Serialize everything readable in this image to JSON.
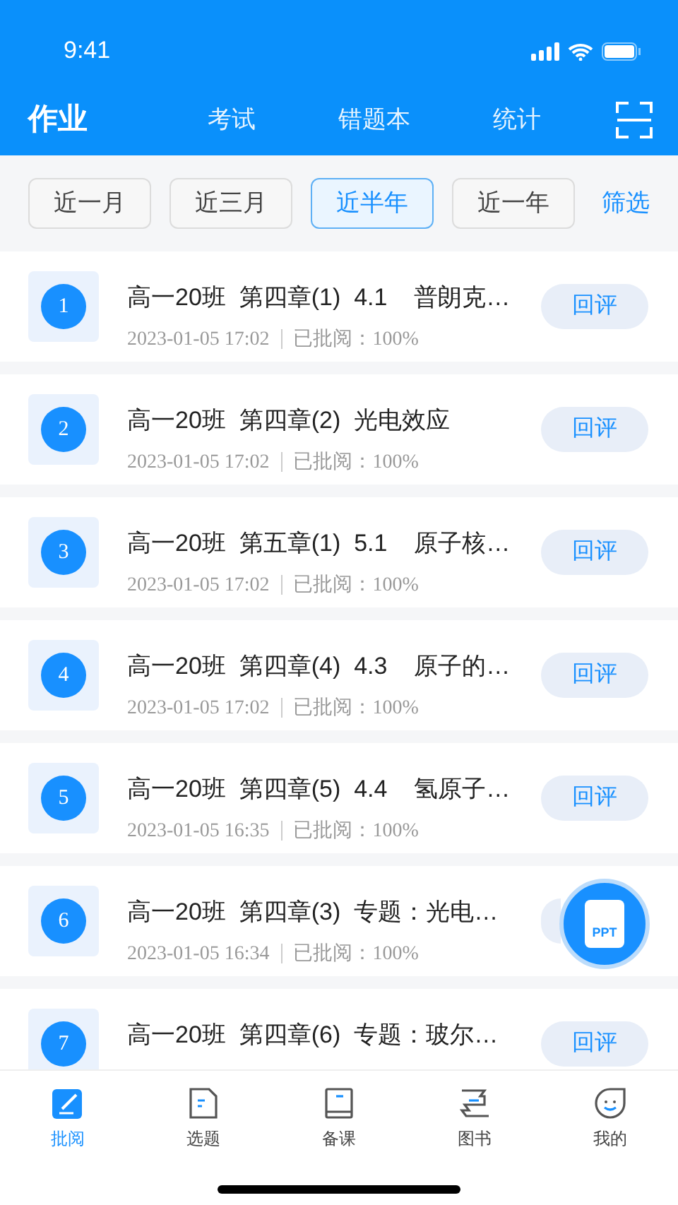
{
  "status_bar": {
    "time": "9:41"
  },
  "nav": {
    "title": "作业",
    "tabs": [
      {
        "label": "考试",
        "selected": false
      },
      {
        "label": "错题本",
        "selected": false
      },
      {
        "label": "统计",
        "selected": false
      }
    ]
  },
  "filters": {
    "options": [
      {
        "label": "近一月",
        "selected": false
      },
      {
        "label": "近三月",
        "selected": false
      },
      {
        "label": "近半年",
        "selected": true
      },
      {
        "label": "近一年",
        "selected": false
      }
    ],
    "action": "筛选"
  },
  "items": [
    {
      "number": "1",
      "title": "高一20班  第四章(1)  4.1    普朗克…",
      "date": "2023-01-05 17:02",
      "review": "已批阅：100%",
      "button": "回评"
    },
    {
      "number": "2",
      "title": "高一20班  第四章(2)  光电效应",
      "date": "2023-01-05 17:02",
      "review": "已批阅：100%",
      "button": "回评"
    },
    {
      "number": "3",
      "title": "高一20班  第五章(1)  5.1    原子核…",
      "date": "2023-01-05 17:02",
      "review": "已批阅：100%",
      "button": "回评"
    },
    {
      "number": "4",
      "title": "高一20班  第四章(4)  4.3    原子的…",
      "date": "2023-01-05 17:02",
      "review": "已批阅：100%",
      "button": "回评"
    },
    {
      "number": "5",
      "title": "高一20班  第四章(5)  4.4    氢原子…",
      "date": "2023-01-05 16:35",
      "review": "已批阅：100%",
      "button": "回评"
    },
    {
      "number": "6",
      "title": "高一20班  第四章(3)  专题：光电…",
      "date": "2023-01-05 16:34",
      "review": "已批阅：100%"
    },
    {
      "number": "7",
      "title": "高一20班  第四章(6)  专题：玻尔…",
      "button": "回评"
    }
  ],
  "fab": {
    "label": "PPT"
  },
  "tab_bar": [
    {
      "label": "批阅",
      "selected": true,
      "kind": "pen"
    },
    {
      "label": "选题",
      "selected": false,
      "kind": "doc"
    },
    {
      "label": "备课",
      "selected": false,
      "kind": "book"
    },
    {
      "label": "图书",
      "selected": false,
      "kind": "books"
    },
    {
      "label": "我的",
      "selected": false,
      "kind": "face"
    }
  ]
}
